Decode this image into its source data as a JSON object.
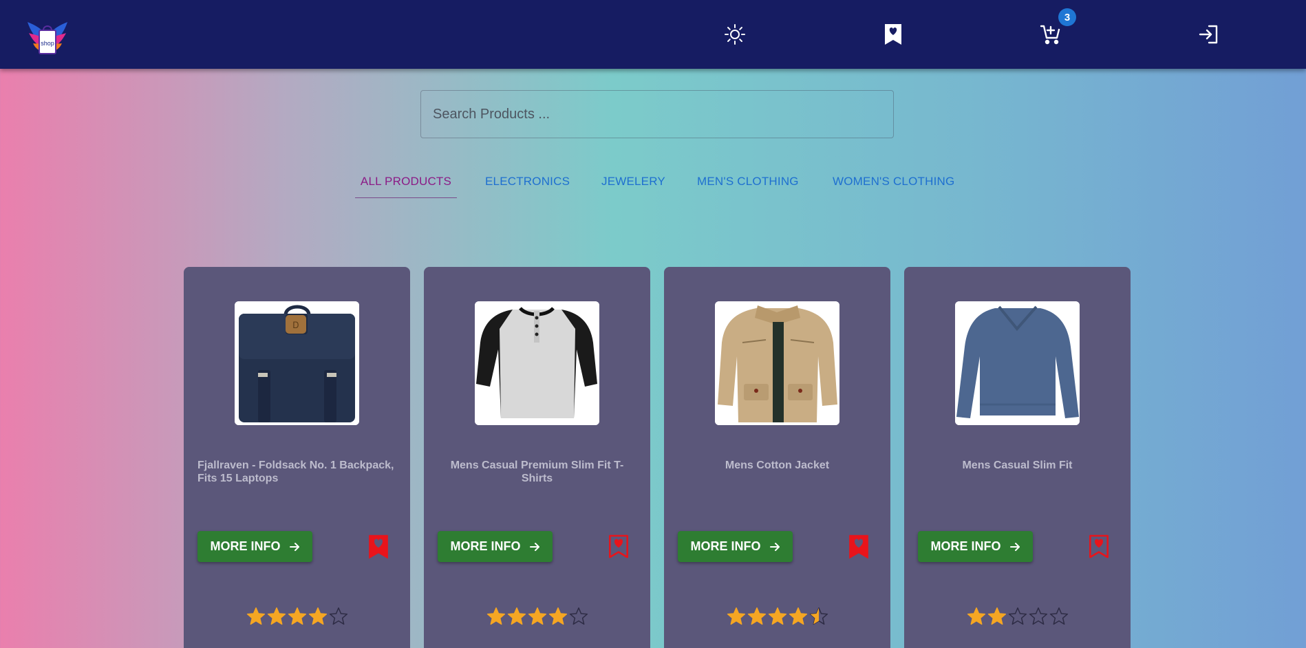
{
  "header": {
    "logo_text": "shop",
    "cart_count": "3",
    "icons": [
      "sun-icon",
      "bookmark-heart-icon",
      "cart-plus-icon",
      "login-icon"
    ]
  },
  "search": {
    "placeholder": "Search Products ...",
    "value": ""
  },
  "tabs": [
    {
      "label": "ALL PRODUCTS",
      "active": true
    },
    {
      "label": "ELECTRONICS",
      "active": false
    },
    {
      "label": "JEWELERY",
      "active": false
    },
    {
      "label": "MEN'S CLOTHING",
      "active": false
    },
    {
      "label": "WOMEN'S CLOTHING",
      "active": false
    }
  ],
  "colors": {
    "header_bg": "#161c62",
    "card_bg": "#5b577a",
    "button_green": "#2e7d32",
    "bookmark_red": "#e8141b",
    "star_gold": "#f5a623",
    "tab_blue": "#1e6fd0",
    "tab_active": "#8b1b86"
  },
  "products": [
    {
      "title": "Fjallraven - Foldsack No. 1 Backpack, Fits 15 Laptops",
      "button": "MORE INFO",
      "bookmarked": true,
      "rating": 4,
      "image": "navy backpack"
    },
    {
      "title": "Mens Casual Premium Slim Fit T-Shirts",
      "button": "MORE INFO",
      "bookmarked": false,
      "rating": 4,
      "image": "raglan henley t-shirt"
    },
    {
      "title": "Mens Cotton Jacket",
      "button": "MORE INFO",
      "bookmarked": true,
      "rating": 4.5,
      "image": "khaki cotton jacket"
    },
    {
      "title": "Mens Casual Slim Fit",
      "button": "MORE INFO",
      "bookmarked": false,
      "rating": 2,
      "image": "blue long sleeve shirt"
    }
  ]
}
